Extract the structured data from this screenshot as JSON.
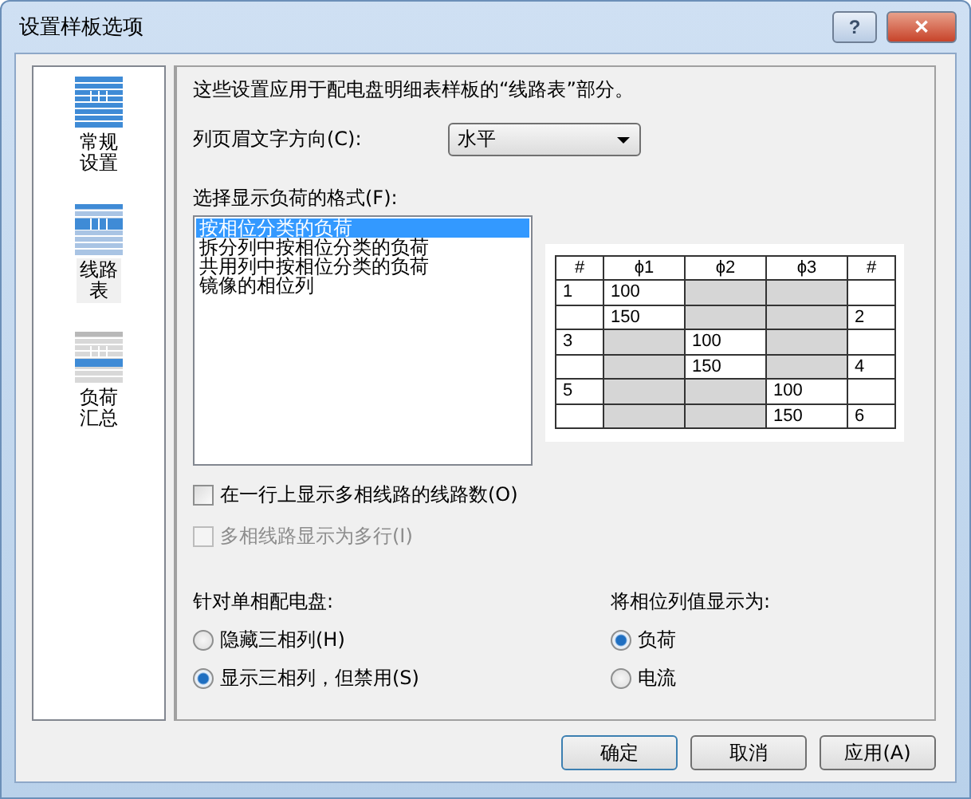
{
  "window": {
    "title": "设置样板选项",
    "help": "?",
    "close": "✕"
  },
  "sidebar": {
    "items": [
      {
        "label": "常规设置",
        "selected": false,
        "kind": "general"
      },
      {
        "label": "线路表",
        "selected": true,
        "kind": "circuits"
      },
      {
        "label": "负荷汇总",
        "selected": false,
        "kind": "summary"
      }
    ]
  },
  "description": "这些设置应用于配电盘明细表样板的“线路表”部分。",
  "header_direction": {
    "label": "列页眉文字方向(C):",
    "value": "水平"
  },
  "format": {
    "label": "选择显示负荷的格式(F):",
    "items": [
      {
        "label": "按相位分类的负荷",
        "selected": true
      },
      {
        "label": "拆分列中按相位分类的负荷",
        "selected": false
      },
      {
        "label": "共用列中按相位分类的负荷",
        "selected": false
      },
      {
        "label": "镜像的相位列",
        "selected": false
      }
    ]
  },
  "preview": {
    "columns": [
      "#",
      "ϕ1",
      "ϕ2",
      "ϕ3",
      "#"
    ],
    "rows": [
      [
        {
          "text": "1"
        },
        {
          "text": "100"
        },
        {
          "shaded": true
        },
        {
          "shaded": true
        },
        {}
      ],
      [
        {},
        {
          "text": "150"
        },
        {
          "shaded": true
        },
        {
          "shaded": true
        },
        {
          "text": "2"
        }
      ],
      [
        {
          "text": "3"
        },
        {
          "shaded": true
        },
        {
          "text": "100"
        },
        {
          "shaded": true
        },
        {}
      ],
      [
        {},
        {
          "shaded": true
        },
        {
          "text": "150"
        },
        {
          "shaded": true
        },
        {
          "text": "4"
        }
      ],
      [
        {
          "text": "5"
        },
        {
          "shaded": true
        },
        {
          "shaded": true
        },
        {
          "text": "100"
        },
        {}
      ],
      [
        {},
        {
          "shaded": true
        },
        {
          "shaded": true
        },
        {
          "text": "150"
        },
        {
          "text": "6"
        }
      ]
    ]
  },
  "checkboxes": [
    {
      "label": "在一行上显示多相线路的线路数(O)",
      "checked": false,
      "disabled": false
    },
    {
      "label": "多相线路显示为多行(I)",
      "checked": false,
      "disabled": true
    }
  ],
  "radio_groups": [
    {
      "label": "针对单相配电盘:",
      "options": [
        {
          "label": "隐藏三相列(H)",
          "selected": false
        },
        {
          "label": "显示三相列，但禁用(S)",
          "selected": true
        }
      ]
    },
    {
      "label": "将相位列值显示为:",
      "options": [
        {
          "label": "负荷",
          "selected": true
        },
        {
          "label": "电流",
          "selected": false
        }
      ]
    }
  ],
  "buttons": [
    {
      "label": "确定",
      "default": true
    },
    {
      "label": "取消",
      "default": false
    },
    {
      "label": "应用(A)",
      "default": false
    }
  ]
}
